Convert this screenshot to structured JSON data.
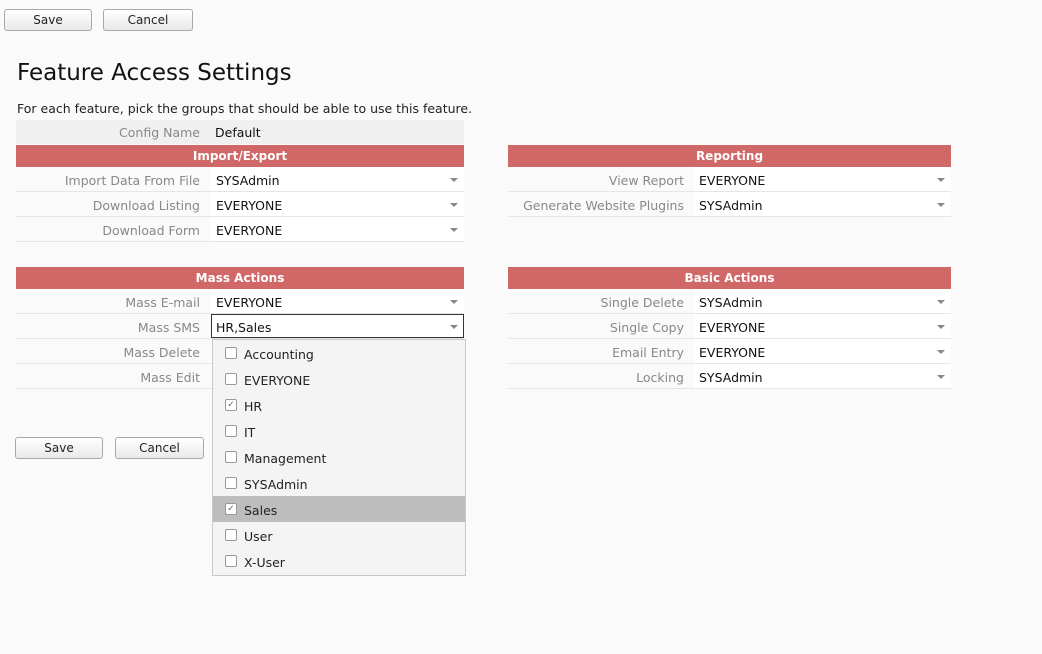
{
  "top_buttons": {
    "save": "Save",
    "cancel": "Cancel"
  },
  "bottom_buttons": {
    "save": "Save",
    "cancel": "Cancel"
  },
  "title": "Feature Access Settings",
  "description": "For each feature, pick the groups that should be able to use this feature.",
  "config": {
    "label": "Config Name",
    "value": "Default"
  },
  "sections": {
    "import_export": {
      "title": "Import/Export",
      "rows": [
        {
          "label": "Import Data From File",
          "value": "SYSAdmin"
        },
        {
          "label": "Download Listing",
          "value": "EVERYONE"
        },
        {
          "label": "Download Form",
          "value": "EVERYONE"
        }
      ]
    },
    "reporting": {
      "title": "Reporting",
      "rows": [
        {
          "label": "View Report",
          "value": "EVERYONE"
        },
        {
          "label": "Generate Website Plugins",
          "value": "SYSAdmin"
        }
      ]
    },
    "mass_actions": {
      "title": "Mass Actions",
      "rows": [
        {
          "label": "Mass E-mail",
          "value": "EVERYONE"
        },
        {
          "label": "Mass SMS",
          "value": "HR,Sales"
        },
        {
          "label": "Mass Delete",
          "value": ""
        },
        {
          "label": "Mass Edit",
          "value": ""
        }
      ]
    },
    "basic_actions": {
      "title": "Basic Actions",
      "rows": [
        {
          "label": "Single Delete",
          "value": "SYSAdmin"
        },
        {
          "label": "Single Copy",
          "value": "EVERYONE"
        },
        {
          "label": "Email Entry",
          "value": "EVERYONE"
        },
        {
          "label": "Locking",
          "value": "SYSAdmin"
        }
      ]
    }
  },
  "dropdown": {
    "options": [
      {
        "label": "Accounting",
        "checked": false
      },
      {
        "label": "EVERYONE",
        "checked": false
      },
      {
        "label": "HR",
        "checked": true
      },
      {
        "label": "IT",
        "checked": false
      },
      {
        "label": "Management",
        "checked": false
      },
      {
        "label": "SYSAdmin",
        "checked": false
      },
      {
        "label": "Sales",
        "checked": true,
        "highlighted": true
      },
      {
        "label": "User",
        "checked": false
      },
      {
        "label": "X-User",
        "checked": false
      }
    ]
  }
}
